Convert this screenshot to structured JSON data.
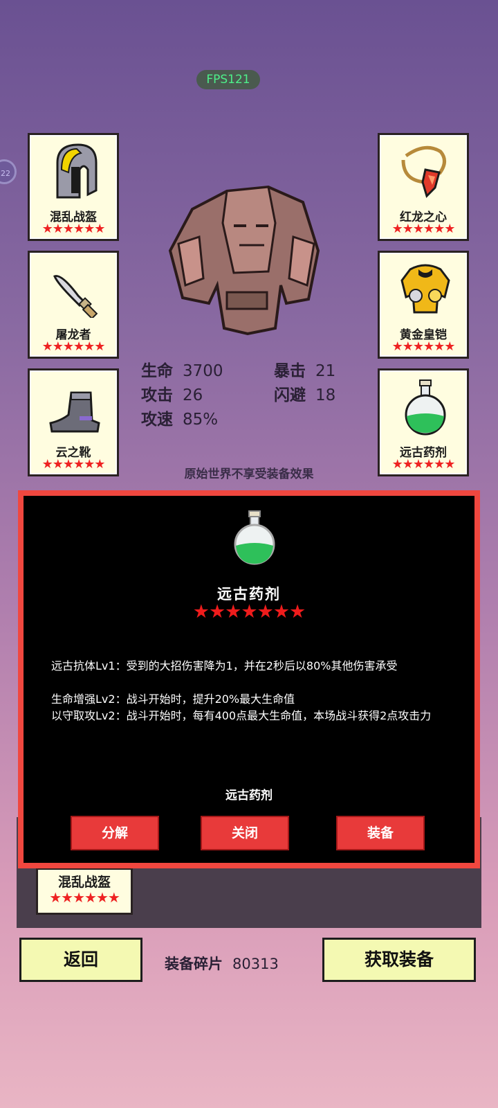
{
  "fps": "FPS121",
  "side_tab_label": "22",
  "slots": {
    "left": [
      {
        "name": "混乱战盔",
        "icon": "helmet-icon",
        "stars": 6
      },
      {
        "name": "屠龙者",
        "icon": "dagger-icon",
        "stars": 6
      },
      {
        "name": "云之靴",
        "icon": "boot-icon",
        "stars": 6
      }
    ],
    "right": [
      {
        "name": "红龙之心",
        "icon": "amulet-icon",
        "stars": 6
      },
      {
        "name": "黄金皇铠",
        "icon": "gold-armor-icon",
        "stars": 6
      },
      {
        "name": "远古药剂",
        "icon": "potion-icon",
        "stars": 6
      }
    ]
  },
  "stats": {
    "hp_label": "生命",
    "hp": "3700",
    "atk_label": "攻击",
    "atk": "26",
    "aspd_label": "攻速",
    "aspd": "85%",
    "crit_label": "暴击",
    "crit": "21",
    "dodge_label": "闪避",
    "dodge": "18"
  },
  "note": "原始世界不享受装备效果",
  "modal": {
    "item_name": "远古药剂",
    "stars": 7,
    "desc": [
      "远古抗体Lv1：受到的大招伤害降为1，并在2秒后以80%其他伤害承受",
      "生命增强Lv2：战斗开始时，提升20%最大生命值",
      "以守取攻Lv2：战斗开始时，每有400点最大生命值，本场战斗获得2点攻击力"
    ],
    "footer": "远古药剂",
    "buttons": {
      "decompose": "分解",
      "close": "关闭",
      "equip": "装备"
    }
  },
  "inventory": {
    "item": "混乱战盔",
    "stars": 6
  },
  "bottom": {
    "back": "返回",
    "shards_label": "装备碎片",
    "shards_value": "80313",
    "get_equip": "获取装备"
  },
  "colors": {
    "star": "#e22222",
    "button_red": "#e83a3a",
    "modal_border": "#f0473f",
    "card_bg": "#fffde0",
    "bottom_btn": "#f4f9b2"
  }
}
